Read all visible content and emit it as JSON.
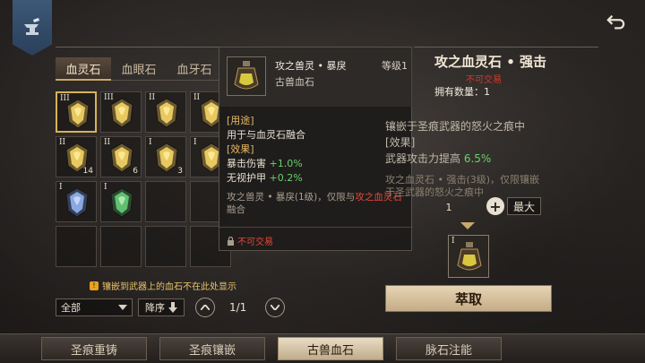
{
  "tabs": [
    {
      "label": "血灵石"
    },
    {
      "label": "血眼石"
    },
    {
      "label": "血牙石"
    }
  ],
  "grid": [
    {
      "tier": "III",
      "count": "",
      "gem": "gold",
      "selected": true
    },
    {
      "tier": "III",
      "count": "",
      "gem": "gold"
    },
    {
      "tier": "II",
      "count": "",
      "gem": "gold"
    },
    {
      "tier": "II",
      "count": "",
      "gem": "gold"
    },
    {
      "tier": "II",
      "count": "14",
      "gem": "gold"
    },
    {
      "tier": "II",
      "count": "6",
      "gem": "gold"
    },
    {
      "tier": "I",
      "count": "3",
      "gem": "gold"
    },
    {
      "tier": "I",
      "count": "",
      "gem": "gold"
    },
    {
      "tier": "I",
      "count": "",
      "gem": "blue"
    },
    {
      "tier": "I",
      "count": "",
      "gem": "green"
    },
    {
      "tier": "",
      "count": "",
      "gem": ""
    },
    {
      "tier": "",
      "count": "",
      "gem": ""
    },
    {
      "tier": "",
      "count": "",
      "gem": ""
    },
    {
      "tier": "",
      "count": "",
      "gem": ""
    },
    {
      "tier": "",
      "count": "",
      "gem": ""
    },
    {
      "tier": "",
      "count": "",
      "gem": ""
    }
  ],
  "notice": "镶嵌到武器上的血石不在此处显示",
  "filter": {
    "value": "全部"
  },
  "sort": {
    "label": "降序"
  },
  "pagination": {
    "page": "1/1"
  },
  "tooltip": {
    "name": "攻之兽灵 • 暴戾",
    "level": "等级1",
    "type": "古兽血石",
    "usage_header": "[用途]",
    "usage_text": "用于与血灵石融合",
    "effect_header": "[效果]",
    "effects": [
      {
        "label": "暴击伤害",
        "value": "+1.0%"
      },
      {
        "label": "无视护甲",
        "value": "+0.2%"
      }
    ],
    "note_prefix": "攻之兽灵 • 暴戾(1级)，仅限与",
    "note_red": "攻之血灵石",
    "note_suffix": "融合",
    "trade": "不可交易"
  },
  "detail": {
    "title": "攻之血灵石 • 强击",
    "trade": "不可交易",
    "own_label": "拥有数量：",
    "own_value": "1",
    "line1": "镶嵌于圣痕武器的怒火之痕中",
    "line2": "[效果]",
    "line3_prefix": "武器攻击力提高",
    "line3_value": "6.5%",
    "line4": "攻之血灵石 • 强击(3级)，仅限镶嵌",
    "line5": "于圣武器的怒火之痕中",
    "qty": "1",
    "max_label": "最大",
    "slot_tier": "I",
    "extract_label": "萃取"
  },
  "bottom_nav": [
    {
      "label": "圣痕重铸"
    },
    {
      "label": "圣痕镶嵌"
    },
    {
      "label": "古兽血石",
      "active": true
    },
    {
      "label": "脉石注能"
    }
  ],
  "colors": {
    "accent_gold": "#d8b25a",
    "red": "#e04a3a",
    "green": "#6ad06a"
  }
}
